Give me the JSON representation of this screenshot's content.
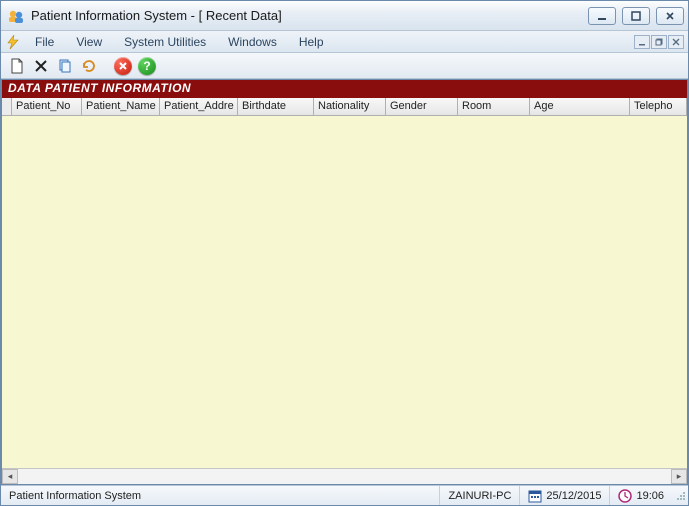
{
  "window": {
    "title": "Patient Information System - [ Recent Data]"
  },
  "menu": {
    "file": "File",
    "view": "View",
    "system_utilities": "System Utilities",
    "windows": "Windows",
    "help": "Help"
  },
  "banner": {
    "text": "DATA PATIENT INFORMATION"
  },
  "columns": {
    "patient_no": "Patient_No",
    "patient_name": "Patient_Name",
    "patient_addre": "Patient_Addre",
    "birthdate": "Birthdate",
    "nationality": "Nationality",
    "gender": "Gender",
    "room": "Room",
    "age": "Age",
    "telepho": "Telepho"
  },
  "status": {
    "app": "Patient Information System",
    "host": "ZAINURI-PC",
    "date": "25/12/2015",
    "time": "19:06"
  }
}
